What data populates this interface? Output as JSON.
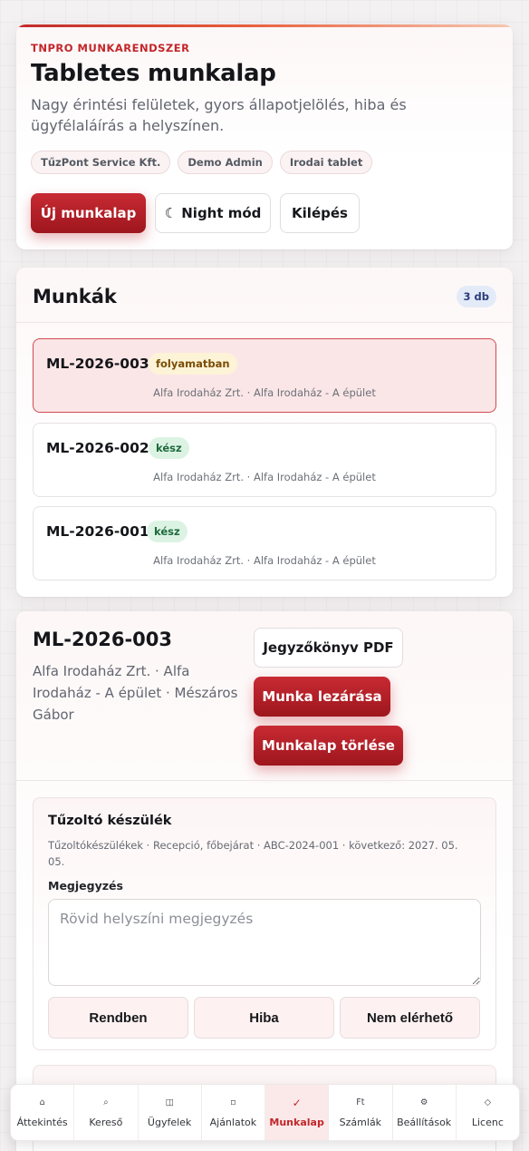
{
  "header": {
    "eyebrow": "TNPRO MUNKARENDSZER",
    "title": "Tabletes munkalap",
    "subtitle": "Nagy érintési felületek, gyors állapotjelölés, hiba és ügyfélaláírás a helyszínen.",
    "chips": [
      "TűzPont Service Kft.",
      "Demo Admin",
      "Irodai tablet"
    ],
    "actions": {
      "new": "Új munkalap",
      "night": "☾ Night mód",
      "logout": "Kilépés"
    }
  },
  "jobs": {
    "title": "Munkák",
    "count": "3 db",
    "items": [
      {
        "id": "ML-2026-003",
        "status": "folyamatban",
        "meta": "Alfa Irodaház Zrt. · Alfa Irodaház - A épület"
      },
      {
        "id": "ML-2026-002",
        "status": "kész",
        "meta": "Alfa Irodaház Zrt. · Alfa Irodaház - A épület"
      },
      {
        "id": "ML-2026-001",
        "status": "kész",
        "meta": "Alfa Irodaház Zrt. · Alfa Irodaház - A épület"
      }
    ]
  },
  "detail": {
    "id": "ML-2026-003",
    "meta": "Alfa Irodaház Zrt. · Alfa Irodaház - A épület · Mészáros Gábor",
    "actions": {
      "pdf": "Jegyzőkönyv PDF",
      "close": "Munka lezárása",
      "delete": "Munkalap törlése"
    },
    "item": {
      "title": "Tűzoltó készülék",
      "meta": "Tűzoltókészülékek · Recepció, főbejárat · ABC-2024-001 · következő: 2027. 05. 05.",
      "note_label": "Megjegyzés",
      "note_placeholder": "Rövid helyszíni megjegyzés",
      "states": [
        "Rendben",
        "Hiba",
        "Nem elérhető"
      ]
    }
  },
  "nav": {
    "items": [
      {
        "icon": "⌂",
        "label": "Áttekintés"
      },
      {
        "icon": "⌕",
        "label": "Kereső"
      },
      {
        "icon": "◫",
        "label": "Ügyfelek"
      },
      {
        "icon": "▫",
        "label": "Ajánlatok"
      },
      {
        "icon": "✓",
        "label": "Munkalap"
      },
      {
        "icon": "Ft",
        "label": "Számlák"
      },
      {
        "icon": "⚙",
        "label": "Beállítások"
      },
      {
        "icon": "◇",
        "label": "Licenc"
      }
    ],
    "active": "Munkalap"
  },
  "colors": {
    "accent": "#c2262a",
    "primary_button": "#b01f27",
    "status_progress_bg": "#fdf3d6",
    "status_done_bg": "#dcf3e4"
  }
}
